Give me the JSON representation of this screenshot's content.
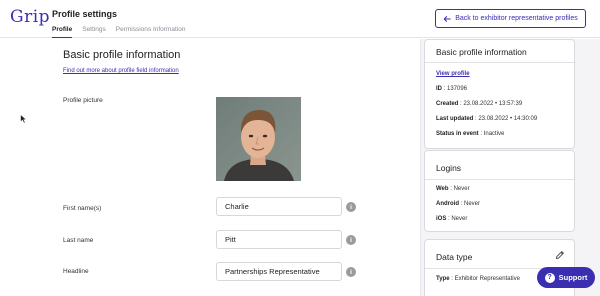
{
  "app": {
    "logo_text": "Grip"
  },
  "header": {
    "title": "Profile settings",
    "tabs": [
      {
        "label": "Profile",
        "active": true
      },
      {
        "label": "Settings",
        "active": false
      },
      {
        "label": "Permissions Information",
        "active": false
      }
    ],
    "back_button": "Back to exhibitor representative profiles"
  },
  "main": {
    "section_title": "Basic profile information",
    "info_link": "Find out more about profile field information",
    "fields": {
      "profile_picture_label": "Profile picture",
      "first_name_label": "First name(s)",
      "first_name_value": "Charlie",
      "last_name_label": "Last name",
      "last_name_value": "Pitt",
      "headline_label": "Headline",
      "headline_value": "Partnerships Representative"
    },
    "info_icon_glyph": "i"
  },
  "sidebar": {
    "basic": {
      "title": "Basic profile information",
      "view_profile": "View profile",
      "id_label": "ID",
      "id_value": ": 137096",
      "created_label": "Created",
      "created_value": ": 23.08.2022 • 13:57:39",
      "updated_label": "Last updated",
      "updated_value": ": 23.08.2022 • 14:30:09",
      "status_label": "Status in event",
      "status_value": ": Inactive"
    },
    "logins": {
      "title": "Logins",
      "web_label": "Web",
      "web_value": ": Never",
      "android_label": "Android",
      "android_value": ": Never",
      "ios_label": "iOS",
      "ios_value": ": Never"
    },
    "data_type": {
      "title": "Data type",
      "type_label": "Type",
      "type_value": ": Exhibitor Representative"
    }
  },
  "support_button": "Support",
  "colors": {
    "accent": "#3a2fb0",
    "sidebar_bg": "#f4f4f6",
    "border": "#d9d9df"
  },
  "icons": [
    "back-arrow-icon",
    "info-icon",
    "edit-pencil-icon",
    "question-icon",
    "mouse-cursor-icon"
  ]
}
